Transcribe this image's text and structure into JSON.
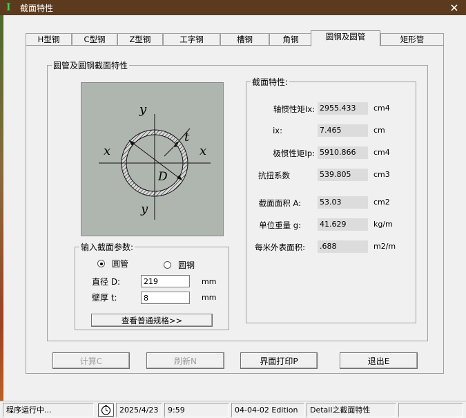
{
  "window": {
    "title": "截面特性",
    "icon_letter": "I",
    "close": "✕"
  },
  "tabs": [
    {
      "label": "H型钢",
      "active": false
    },
    {
      "label": "C型钢",
      "active": false
    },
    {
      "label": "Z型钢",
      "active": false
    },
    {
      "label": "工字钢",
      "active": false
    },
    {
      "label": "槽钢",
      "active": false
    },
    {
      "label": "角钢",
      "active": false
    },
    {
      "label": "圆钢及圆管",
      "active": true
    },
    {
      "label": "矩形管",
      "active": false
    }
  ],
  "panel": {
    "group_title": "圆管及圆钢截面特性",
    "diagram": {
      "y_top": "y",
      "y_bottom": "y",
      "x_left": "x",
      "x_right": "x",
      "t": "t",
      "D": "D"
    },
    "props": {
      "title": "截面特性:",
      "rows": [
        {
          "label": "轴惯性矩Ix:",
          "value": "2955.433",
          "unit": "cm4"
        },
        {
          "label": "ix:",
          "value": "7.465",
          "unit": "cm"
        },
        {
          "label": "极惯性矩Ip:",
          "value": "5910.866",
          "unit": "cm4"
        },
        {
          "label": "抗扭系数",
          "value": "539.805",
          "unit": "cm3"
        },
        {
          "label": "截面面积 A:",
          "value": "53.03",
          "unit": "cm2"
        },
        {
          "label": "单位重量 g:",
          "value": "41.629",
          "unit": "kg/m"
        },
        {
          "label": "每米外表面积:",
          "value": ".688",
          "unit": "m2/m"
        }
      ]
    },
    "input": {
      "title": "输入截面参数:",
      "radio_tube": "圆管",
      "radio_bar": "圆钢",
      "selected": "圆管",
      "diameter_label": "直径 D:",
      "diameter_value": "219",
      "diameter_unit": "mm",
      "thickness_label": "壁厚 t:",
      "thickness_value": "8",
      "thickness_unit": "mm",
      "spec_button": "查看普通规格>>"
    }
  },
  "buttons": {
    "calc": "计算C",
    "refresh": "刷新N",
    "print": "界面打印P",
    "exit": "退出E"
  },
  "status": {
    "state": "程序运行中...",
    "date": "2025/4/23",
    "time": "9:59",
    "edition": "04-04-02 Edition",
    "detail": "Detail之截面特性",
    "extra": ""
  }
}
